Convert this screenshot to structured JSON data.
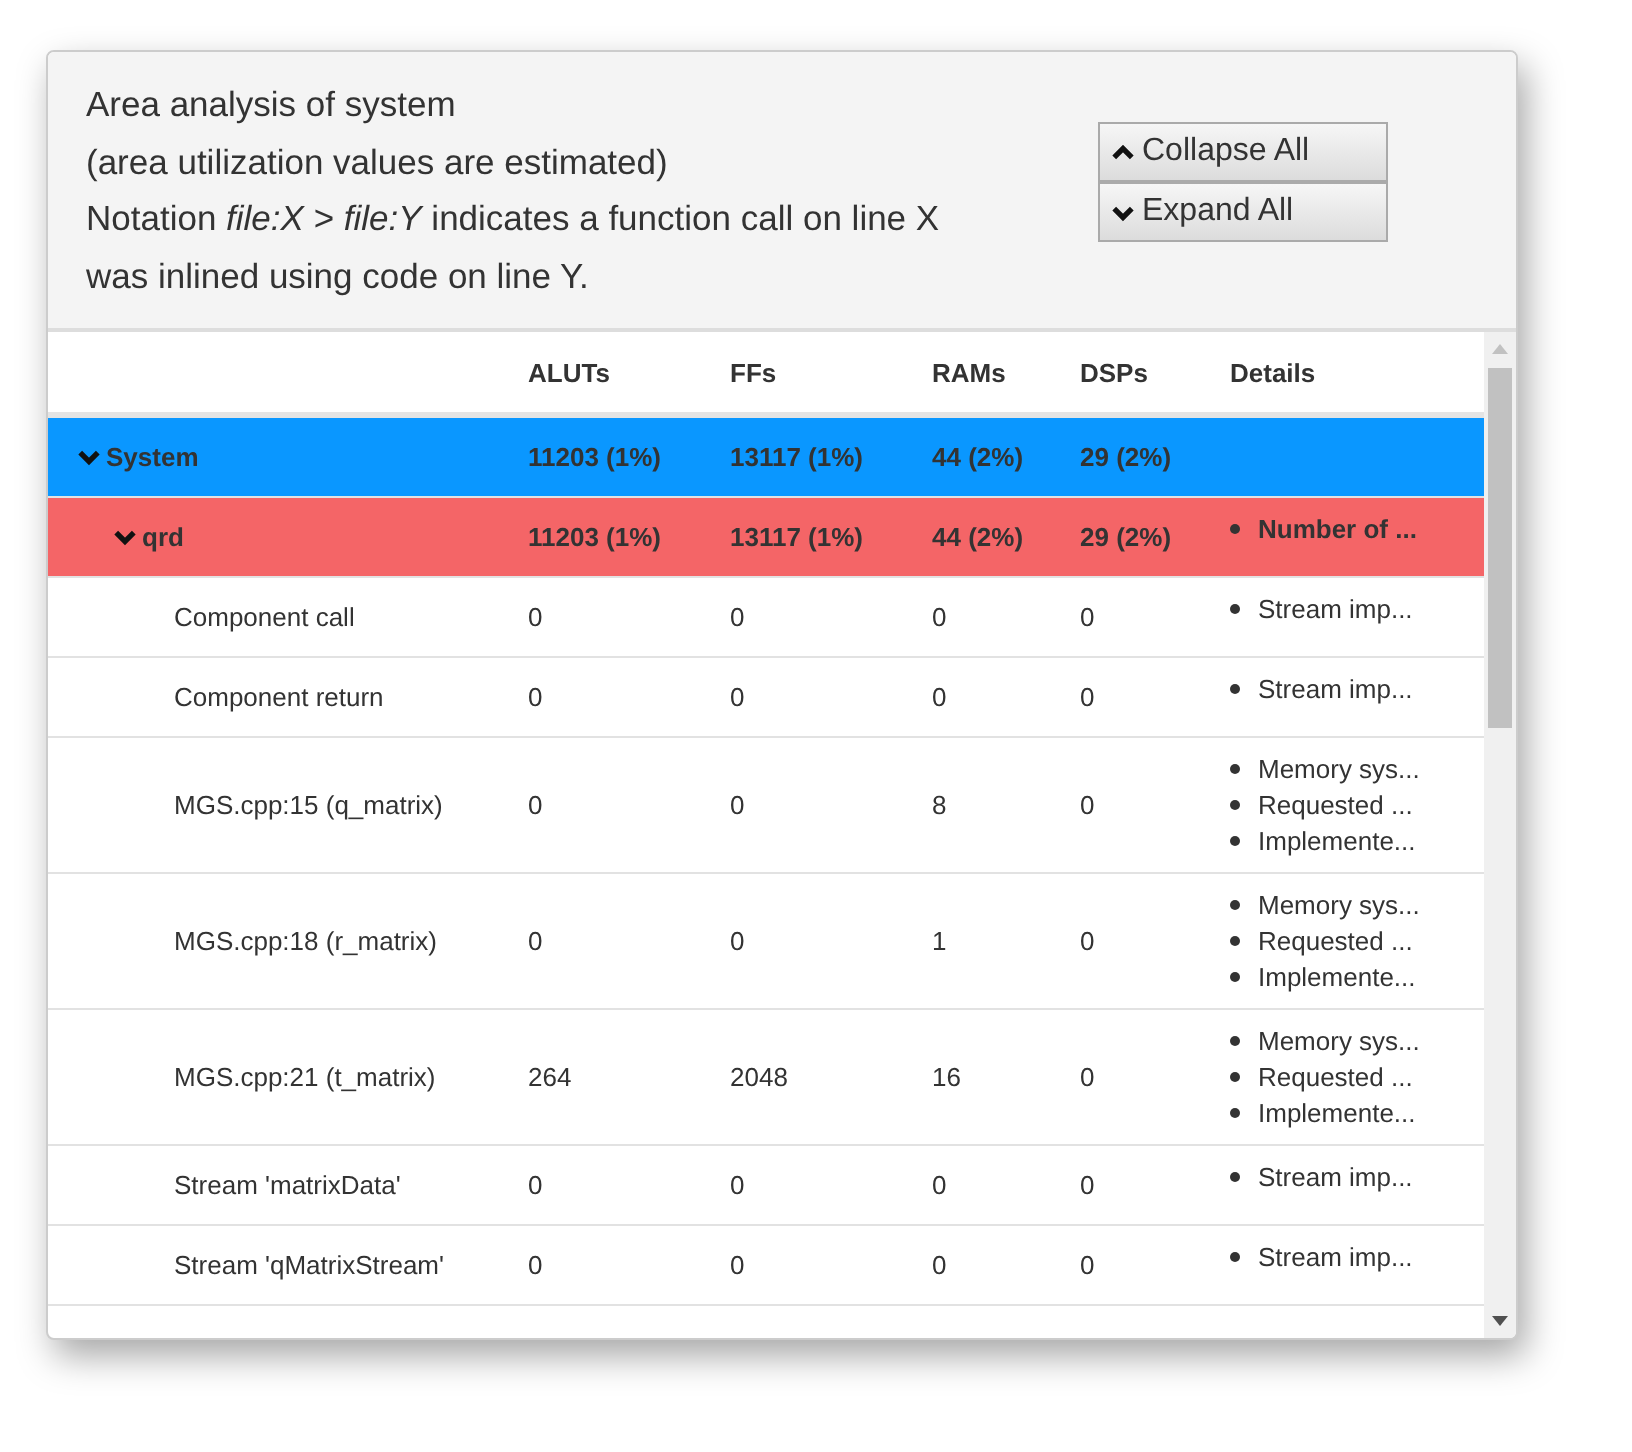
{
  "header": {
    "lines": [
      "Area analysis of system",
      "(area utilization values are estimated)",
      "Notation *file:X* > *file:Y* indicates a function call on line X",
      "was inlined using code on line Y."
    ],
    "buttons": [
      {
        "label": "Collapse All",
        "kind": "collapse"
      },
      {
        "label": "Expand All",
        "kind": "expand"
      }
    ]
  },
  "table": {
    "columns": [
      "",
      "ALUTs",
      "FFs",
      "RAMs",
      "DSPs",
      "Details"
    ],
    "rows": [
      {
        "name": "System",
        "color": "#0a97ff",
        "expanded": true,
        "aluts": "11203 (1%)",
        "ffs": "13117 (1%)",
        "rams": "44 (2%)",
        "dsps": "29 (2%)",
        "details": [],
        "children": [
          {
            "name": "qrd",
            "color": "#f46567",
            "expanded": true,
            "aluts": "11203 (1%)",
            "ffs": "13117 (1%)",
            "rams": "44 (2%)",
            "dsps": "29 (2%)",
            "details": [
              "Number of ..."
            ],
            "children": [
              {
                "name": "Component call",
                "aluts": "0",
                "ffs": "0",
                "rams": "0",
                "dsps": "0",
                "details": [
                  "Stream imp..."
                ]
              },
              {
                "name": "Component return",
                "aluts": "0",
                "ffs": "0",
                "rams": "0",
                "dsps": "0",
                "details": [
                  "Stream imp..."
                ]
              },
              {
                "name": "MGS.cpp:15 (q_matrix)",
                "aluts": "0",
                "ffs": "0",
                "rams": "8",
                "dsps": "0",
                "details": [
                  "Memory sys...",
                  "Requested ...",
                  "Implemente..."
                ]
              },
              {
                "name": "MGS.cpp:18 (r_matrix)",
                "aluts": "0",
                "ffs": "0",
                "rams": "1",
                "dsps": "0",
                "details": [
                  "Memory sys...",
                  "Requested ...",
                  "Implemente..."
                ]
              },
              {
                "name": "MGS.cpp:21 (t_matrix)",
                "aluts": "264",
                "ffs": "2048",
                "rams": "16",
                "dsps": "0",
                "details": [
                  "Memory sys...",
                  "Requested ...",
                  "Implemente..."
                ]
              },
              {
                "name": "Stream 'matrixData'",
                "aluts": "0",
                "ffs": "0",
                "rams": "0",
                "dsps": "0",
                "details": [
                  "Stream imp..."
                ]
              },
              {
                "name": "Stream 'qMatrixStream'",
                "aluts": "0",
                "ffs": "0",
                "rams": "0",
                "dsps": "0",
                "details": [
                  "Stream imp..."
                ]
              }
            ]
          }
        ]
      }
    ]
  }
}
